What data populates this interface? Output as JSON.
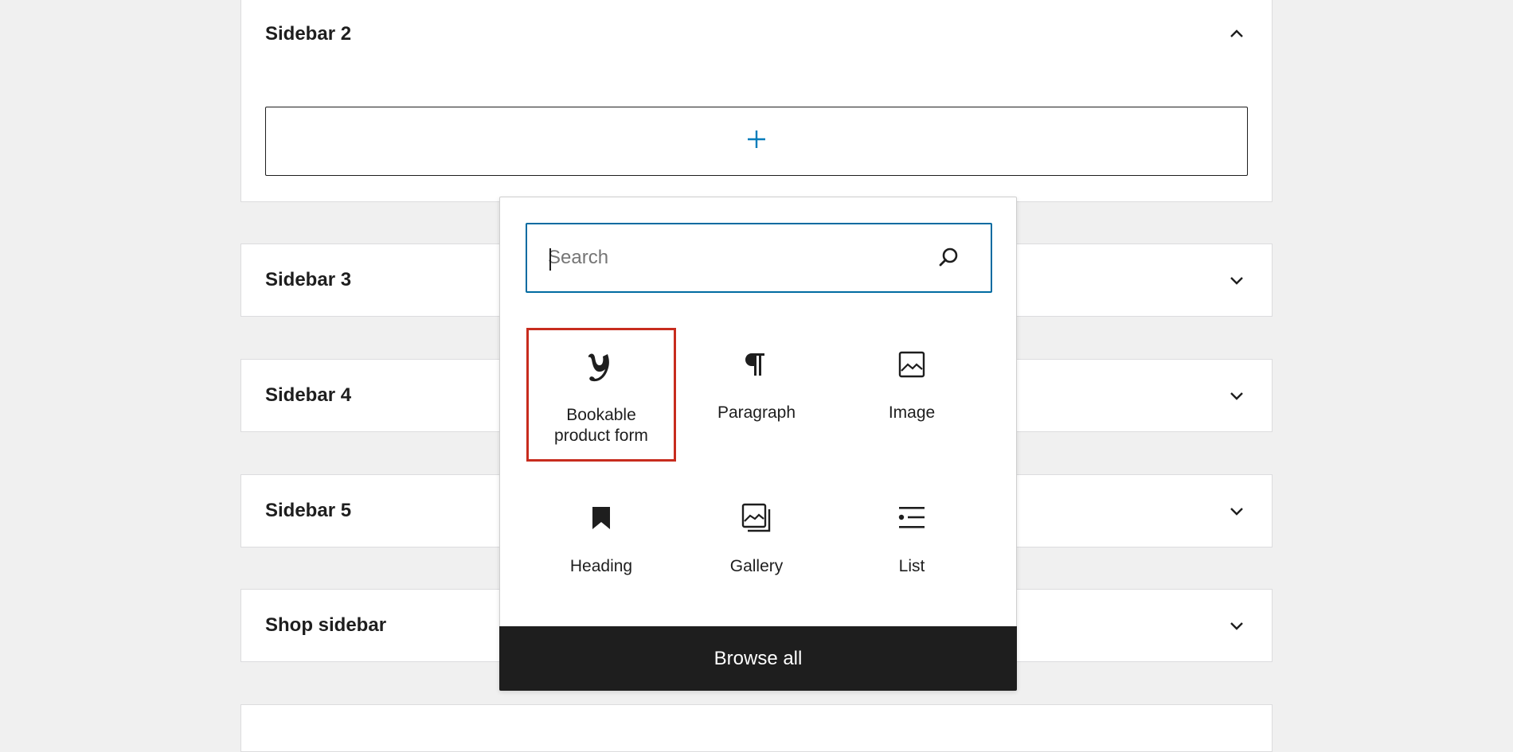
{
  "panels": {
    "sidebar2": {
      "title": "Sidebar 2",
      "expanded": true
    },
    "sidebar3": {
      "title": "Sidebar 3"
    },
    "sidebar4": {
      "title": "Sidebar 4"
    },
    "sidebar5": {
      "title": "Sidebar 5"
    },
    "shop": {
      "title": "Shop sidebar"
    }
  },
  "appender": {
    "icon": "plus-icon",
    "accent_color": "#007cba"
  },
  "inserter": {
    "search": {
      "placeholder": "Search",
      "value": ""
    },
    "blocks": [
      {
        "label": "Bookable product form",
        "icon": "yith-logo-icon",
        "highlighted": true
      },
      {
        "label": "Paragraph",
        "icon": "paragraph-icon"
      },
      {
        "label": "Image",
        "icon": "image-icon"
      },
      {
        "label": "Heading",
        "icon": "bookmark-icon"
      },
      {
        "label": "Gallery",
        "icon": "gallery-icon"
      },
      {
        "label": "List",
        "icon": "list-icon"
      }
    ],
    "browse_all_label": "Browse all",
    "highlight_color": "#c72c1e",
    "focus_color": "#006ba1"
  }
}
